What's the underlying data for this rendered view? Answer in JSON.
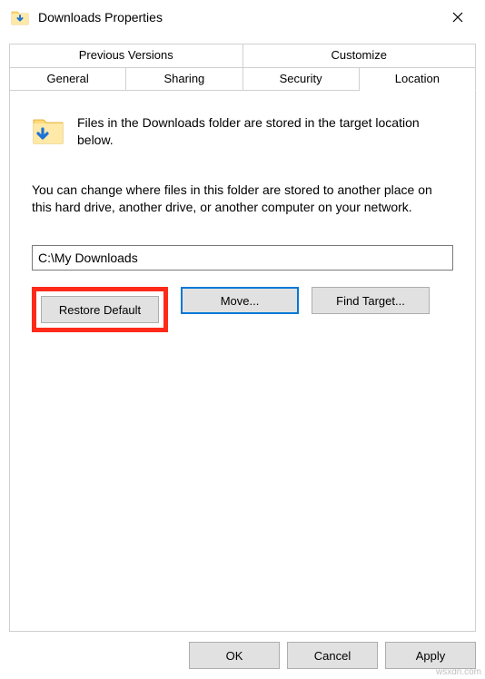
{
  "titlebar": {
    "title": "Downloads Properties"
  },
  "tabs": {
    "row1": [
      "Previous Versions",
      "Customize"
    ],
    "row2": [
      "General",
      "Sharing",
      "Security",
      "Location"
    ]
  },
  "panel": {
    "info": "Files in the Downloads folder are stored in the target location below.",
    "desc": "You can change where files in this folder are stored to another place on this hard drive, another drive, or another computer on your network.",
    "path": "C:\\My Downloads",
    "buttons": {
      "restore": "Restore Default",
      "move": "Move...",
      "find": "Find Target..."
    }
  },
  "footer": {
    "ok": "OK",
    "cancel": "Cancel",
    "apply": "Apply"
  },
  "watermark": "wsxdn.com"
}
